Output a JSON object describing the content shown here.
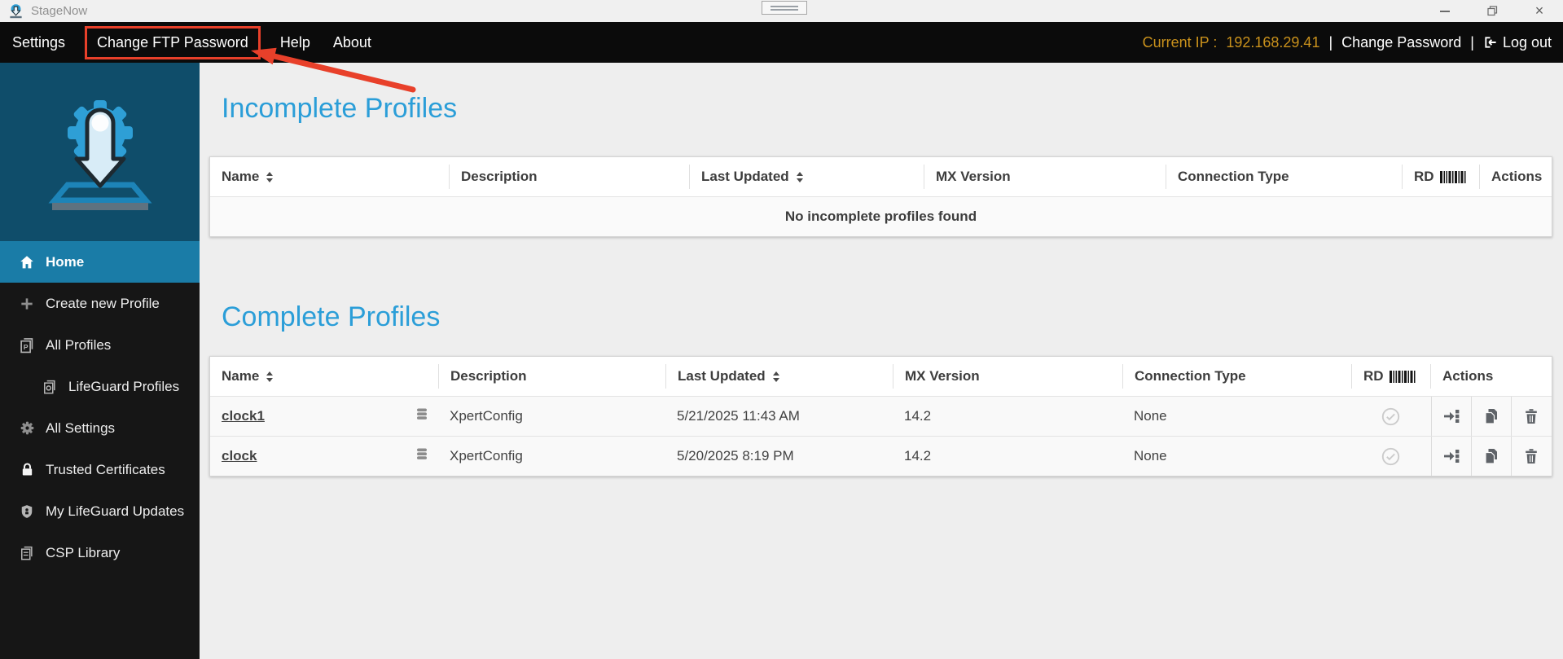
{
  "window": {
    "title": "StageNow",
    "close_glyph": "×",
    "controls": [
      "minimize-icon",
      "restore-icon",
      "close-icon"
    ]
  },
  "menubar": {
    "items": [
      {
        "label": "Settings"
      },
      {
        "label": "Change FTP Password",
        "annotated": true
      },
      {
        "label": "Help"
      },
      {
        "label": "About"
      }
    ],
    "right": {
      "current_ip_label": "Current IP :",
      "current_ip_value": "192.168.29.41",
      "divider": "|",
      "change_password": "Change Password",
      "logout": "Log out",
      "logout_icon": "logout-icon"
    }
  },
  "annotation": {
    "shapes": [
      "red-box around Change FTP Password",
      "red-arrow pointing to it"
    ],
    "color": "#e8402a"
  },
  "sidebar": {
    "logo_icon": "stagenow-logo",
    "items": [
      {
        "label": "Home",
        "icon": "home-icon",
        "active": true
      },
      {
        "label": "Create new Profile",
        "icon": "plus-icon"
      },
      {
        "label": "All Profiles",
        "icon": "profiles-icon"
      },
      {
        "label": "LifeGuard Profiles",
        "icon": "lifeguard-profiles-icon",
        "indent": true
      },
      {
        "label": "All Settings",
        "icon": "gear-icon"
      },
      {
        "label": "Trusted Certificates",
        "icon": "lock-icon"
      },
      {
        "label": "My LifeGuard Updates",
        "icon": "shield-icon"
      },
      {
        "label": "CSP Library",
        "icon": "library-icon"
      }
    ]
  },
  "main": {
    "columns": [
      "Name",
      "Description",
      "Last Updated",
      "MX Version",
      "Connection Type",
      "RD",
      "Actions"
    ],
    "sortable_columns": [
      "Name",
      "Last Updated"
    ],
    "incomplete": {
      "title": "Incomplete Profiles",
      "empty_message": "No incomplete profiles found"
    },
    "complete": {
      "title": "Complete Profiles",
      "row_icons": {
        "name": "database-icon",
        "rd": "check-circle-icon",
        "actions": [
          "stage-icon",
          "copy-icon",
          "delete-icon"
        ]
      },
      "rows": [
        {
          "name": "clock1",
          "description": "XpertConfig",
          "last_updated": "5/21/2025 11:43 AM",
          "mx_version": "14.2",
          "connection_type": "None"
        },
        {
          "name": "clock",
          "description": "XpertConfig",
          "last_updated": "5/20/2025 8:19 PM",
          "mx_version": "14.2",
          "connection_type": "None"
        }
      ]
    }
  },
  "colors": {
    "heading_blue": "#2b9ed8",
    "active_nav_blue": "#1a7ca7",
    "logo_teal": "#0f4d6a",
    "menubar_black": "#0b0b0b",
    "amber_ip": "#c9911c",
    "annotation_red": "#e8402a"
  }
}
